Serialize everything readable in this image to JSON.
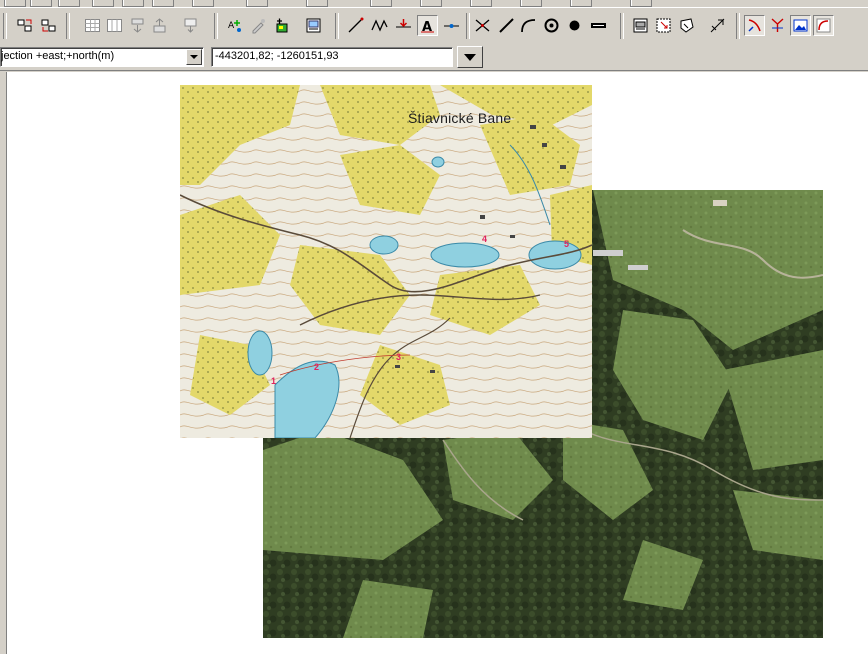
{
  "toolbar": {
    "buttons": [
      {
        "name": "move-up-icon"
      },
      {
        "name": "move-down-icon"
      },
      {
        "name": "table-icon"
      },
      {
        "name": "table-columns-icon"
      },
      {
        "name": "sort-icon"
      },
      {
        "name": "filter-icon"
      },
      {
        "name": "export-icon"
      },
      {
        "name": "add-point-icon"
      },
      {
        "name": "edit-point-icon"
      },
      {
        "name": "add-layer-icon"
      },
      {
        "name": "properties-icon"
      },
      {
        "name": "line-icon"
      },
      {
        "name": "polyline-icon"
      },
      {
        "name": "arrow-point-icon"
      },
      {
        "name": "text-icon"
      },
      {
        "name": "node-icon"
      },
      {
        "name": "cross-icon"
      },
      {
        "name": "segment-icon"
      },
      {
        "name": "arc-icon"
      },
      {
        "name": "circle-icon"
      },
      {
        "name": "dot-icon"
      },
      {
        "name": "bar-icon"
      },
      {
        "name": "layer-props-icon"
      },
      {
        "name": "select-icon"
      },
      {
        "name": "shape-icon"
      },
      {
        "name": "snap-icon"
      },
      {
        "name": "georef-icon"
      },
      {
        "name": "branch-icon"
      },
      {
        "name": "image-icon"
      },
      {
        "name": "curve-icon"
      }
    ]
  },
  "coords": {
    "projection_value": "jection +east;+north(m)",
    "cursor_position": "-443201,82; -1260151,93"
  },
  "map": {
    "topo_place_name": "Štiavnické Bane",
    "control_points": [
      "1",
      "2",
      "3",
      "4",
      "5"
    ]
  },
  "colors": {
    "window_face": "#d4d0c8",
    "canvas_bg": "#ffffff",
    "topo_yellow": "#e3d86a",
    "water_blue": "#8fd0e0",
    "control_point_red": "#e0245e"
  }
}
